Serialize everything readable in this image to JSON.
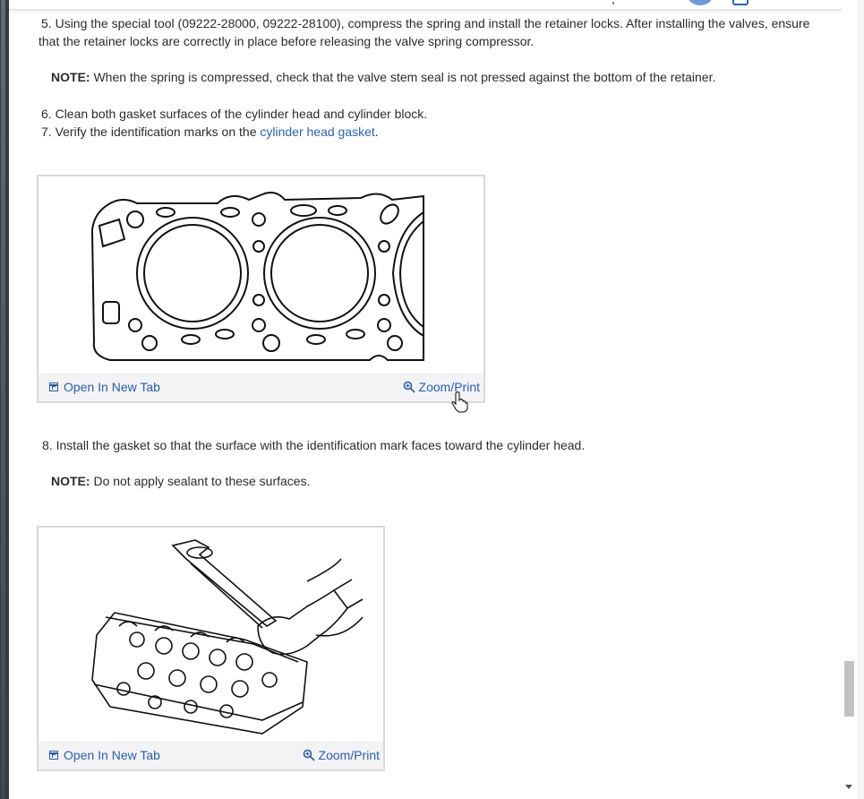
{
  "steps": {
    "step5": {
      "number": "5.",
      "text": "Using the special tool (09222-28000, 09222-28100), compress the spring and install the retainer locks. After installing the valves, ensure",
      "text_cont": "that the retainer locks are correctly in place before releasing the valve spring compressor."
    },
    "note1": {
      "label": "NOTE:",
      "text": " When the spring is compressed, check that the valve stem seal is not pressed against the bottom of the retainer."
    },
    "step6": {
      "number": "6.",
      "text": "Clean both gasket surfaces of the cylinder head and cylinder block."
    },
    "step7": {
      "number": "7.",
      "text": "Verify the identification marks on the ",
      "link": "cylinder head gasket",
      "after": "."
    },
    "step8": {
      "number": "8.",
      "text": "Install the gasket so that the surface with the identification mark faces toward the cylinder head."
    },
    "note2": {
      "label": "NOTE:",
      "text": " Do not apply sealant to these surfaces."
    }
  },
  "figures": {
    "fig1": {
      "open_label": "Open In New Tab",
      "zoom_label": "Zoom/Print",
      "illustration": "cylinder-head-gasket-diagram"
    },
    "fig2": {
      "open_label": "Open In New Tab",
      "zoom_label": "Zoom/Print",
      "illustration": "gasket-installation-diagram"
    }
  },
  "colors": {
    "link": "#2a63ad",
    "text": "#2b2b2b",
    "figure_bar": "#f3f3f5"
  },
  "icons": [
    "open-in-new-tab-icon",
    "zoom-icon",
    "hand-cursor-icon",
    "scroll-down-arrow-icon"
  ]
}
